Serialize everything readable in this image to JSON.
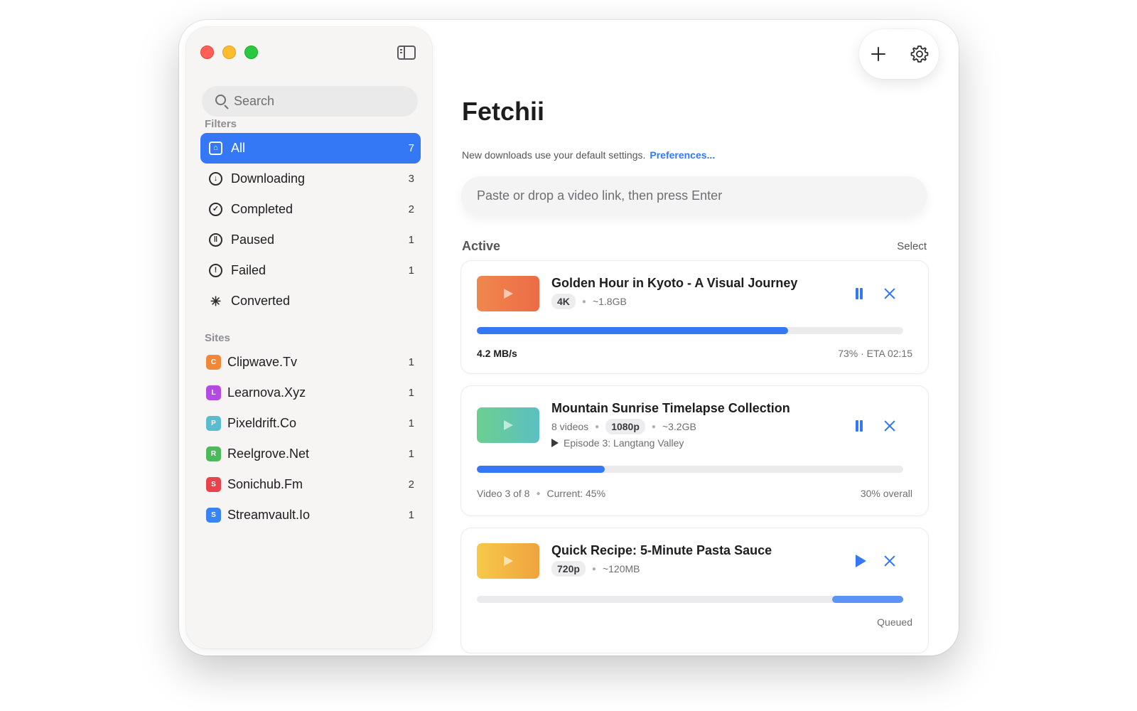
{
  "window": {
    "title": "Fetchii"
  },
  "sidebar": {
    "search_placeholder": "Search",
    "filters_label": "Filters",
    "filters": [
      {
        "label": "All",
        "count": "7",
        "icon": "tray-icon",
        "active": true
      },
      {
        "label": "Downloading",
        "count": "3",
        "icon": "arrow-down-circle-icon"
      },
      {
        "label": "Completed",
        "count": "2",
        "icon": "checkmark-circle-icon"
      },
      {
        "label": "Paused",
        "count": "1",
        "icon": "pause-circle-icon"
      },
      {
        "label": "Failed",
        "count": "1",
        "icon": "exclamation-circle-icon"
      },
      {
        "label": "Converted",
        "count": "",
        "icon": "sparkle-icon"
      }
    ],
    "sites_label": "Sites",
    "sites": [
      {
        "letter": "C",
        "label": "Clipwave.Tv",
        "count": "1",
        "color": "#f0883a"
      },
      {
        "letter": "L",
        "label": "Learnova.Xyz",
        "count": "1",
        "color": "#b44be0"
      },
      {
        "letter": "P",
        "label": "Pixeldrift.Co",
        "count": "1",
        "color": "#5bbcd0"
      },
      {
        "letter": "R",
        "label": "Reelgrove.Net",
        "count": "1",
        "color": "#4cb95a"
      },
      {
        "letter": "S",
        "label": "Sonichub.Fm",
        "count": "2",
        "color": "#e8424c"
      },
      {
        "letter": "S",
        "label": "Streamvault.Io",
        "count": "1",
        "color": "#3a83f5"
      }
    ]
  },
  "main": {
    "title": "Fetchii",
    "hint": "New downloads use your default settings.",
    "hint_link": "Preferences...",
    "url_placeholder": "Paste or drop a video link, then press Enter",
    "active_label": "Active",
    "select_label": "Select",
    "downloads": [
      {
        "title": "Golden Hour in Kyoto - A Visual Journey",
        "quality": "4K",
        "size": "~1.8GB",
        "progress": 0.73,
        "speed": "4.2 MB/s",
        "status": "73% · ETA 02:15",
        "action": "pause",
        "thumb_colors": [
          "#f0884e",
          "#ec6b45"
        ]
      },
      {
        "title": "Mountain Sunrise Timelapse Collection",
        "videos": "8 videos",
        "quality": "1080p",
        "size": "~3.2GB",
        "episode": "Episode 3: Langtang Valley",
        "progress": 0.3,
        "left_status": "Video 3 of 8",
        "current": "Current: 45%",
        "status": "30% overall",
        "action": "pause",
        "thumb_colors": [
          "#6ccf91",
          "#5bbfc1"
        ]
      },
      {
        "title": "Quick Recipe: 5-Minute Pasta Sauce",
        "quality": "720p",
        "size": "~120MB",
        "status": "Queued",
        "action": "resume",
        "thumb_colors": [
          "#f7c94a",
          "#efa33e"
        ]
      }
    ]
  },
  "colors": {
    "accent": "#3478f6"
  }
}
